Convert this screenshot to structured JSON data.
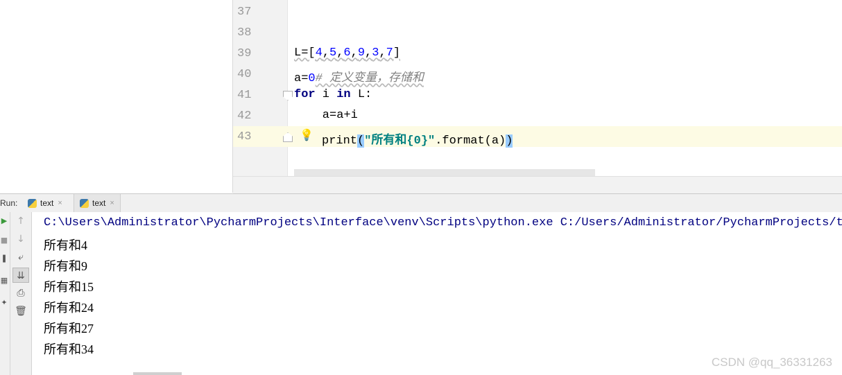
{
  "editor": {
    "lines": [
      {
        "num": "37"
      },
      {
        "num": "38"
      },
      {
        "num": "39",
        "code": {
          "prefix": "L=[",
          "n1": "4",
          "n2": "5",
          "n3": "6",
          "n4": "9",
          "n5": "3",
          "n6": "7",
          "suffix": "]"
        }
      },
      {
        "num": "40",
        "code": {
          "lhs": "a=",
          "zero": "0",
          "comment": "# 定义变量，存储和"
        }
      },
      {
        "num": "41",
        "code": {
          "kw_for": "for",
          "var": " i ",
          "kw_in": "in",
          "rest": " L:"
        }
      },
      {
        "num": "42",
        "code": {
          "text": "    a=a+i"
        }
      },
      {
        "num": "43",
        "code": {
          "fn": "print",
          "lp": "(",
          "str": "\"所有和{0}\"",
          "mid": ".format(a)",
          "rp": ")"
        }
      }
    ]
  },
  "run": {
    "title": "Run:",
    "tabs": [
      {
        "label": "text",
        "close": "×"
      },
      {
        "label": "text",
        "close": "×"
      }
    ]
  },
  "console": {
    "command": "C:\\Users\\Administrator\\PycharmProjects\\Interface\\venv\\Scripts\\python.exe C:/Users/Administrator/PycharmProjects/tex",
    "output": [
      "所有和4",
      "所有和9",
      "所有和15",
      "所有和24",
      "所有和27",
      "所有和34"
    ]
  },
  "watermark": "CSDN @qq_36331263"
}
